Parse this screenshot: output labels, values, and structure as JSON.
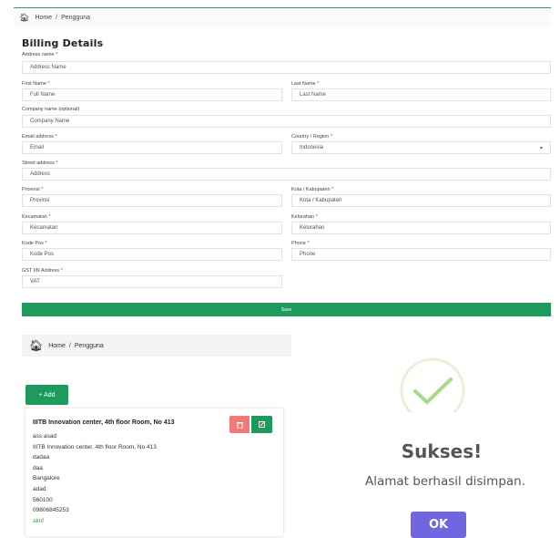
{
  "breadcrumb_top": {
    "home": "Home",
    "sep": "/",
    "current": "Pengguna"
  },
  "form": {
    "title": "Billing Details",
    "required_mark": "*",
    "fields": {
      "address_name": {
        "label": "Address name",
        "value": "Address Name"
      },
      "first_name": {
        "label": "First Name",
        "value": "Full Name"
      },
      "last_name": {
        "label": "Last Name",
        "value": "Last Name"
      },
      "company": {
        "label": "Company name (optional)",
        "value": "Company Name"
      },
      "email": {
        "label": "Email address",
        "value": "Email"
      },
      "country": {
        "label": "Country / Region",
        "value": "Indonesia",
        "caret": "▾"
      },
      "street": {
        "label": "Street address",
        "value": "Address"
      },
      "province": {
        "label": "Provinsi",
        "value": "Provinsi"
      },
      "city": {
        "label": "Kota / Kabupaten",
        "value": "Kota / Kabupaten"
      },
      "district": {
        "label": "Kecamatan",
        "value": "Kecamatan"
      },
      "village": {
        "label": "Kelurahan",
        "value": "Kelurahan"
      },
      "postcode": {
        "label": "Kode Pos",
        "value": "Kode Pos"
      },
      "phone": {
        "label": "Phone",
        "value": "Phone"
      },
      "gst": {
        "label": "GST IIN Address",
        "value": "VAT"
      }
    },
    "save_label": "Save"
  },
  "breadcrumb_bottom": {
    "home": "Home",
    "sep": "/",
    "current": "Pengguna"
  },
  "add_label": "+ Add",
  "address_card": {
    "title": "IIITB Innovation center, 4th floor Room, No 413",
    "lines": [
      "ass asad",
      "IIITB Innovation center, 4th floor Room, No 413",
      "dadaa",
      "daa",
      "Bangalore",
      "adad",
      "560100",
      "09806845253"
    ],
    "status": "aktif",
    "delete_icon": "trash-icon",
    "edit_icon": "edit-icon"
  },
  "dialog": {
    "title": "Sukses!",
    "message": "Alamat berhasil disimpan.",
    "ok_label": "OK"
  },
  "colors": {
    "primary_green": "#1e9a5c",
    "danger_red": "#f07a7a",
    "success_check": "#a5dc86",
    "ok_purple": "#7066e0",
    "status_green": "#2eae4f"
  }
}
